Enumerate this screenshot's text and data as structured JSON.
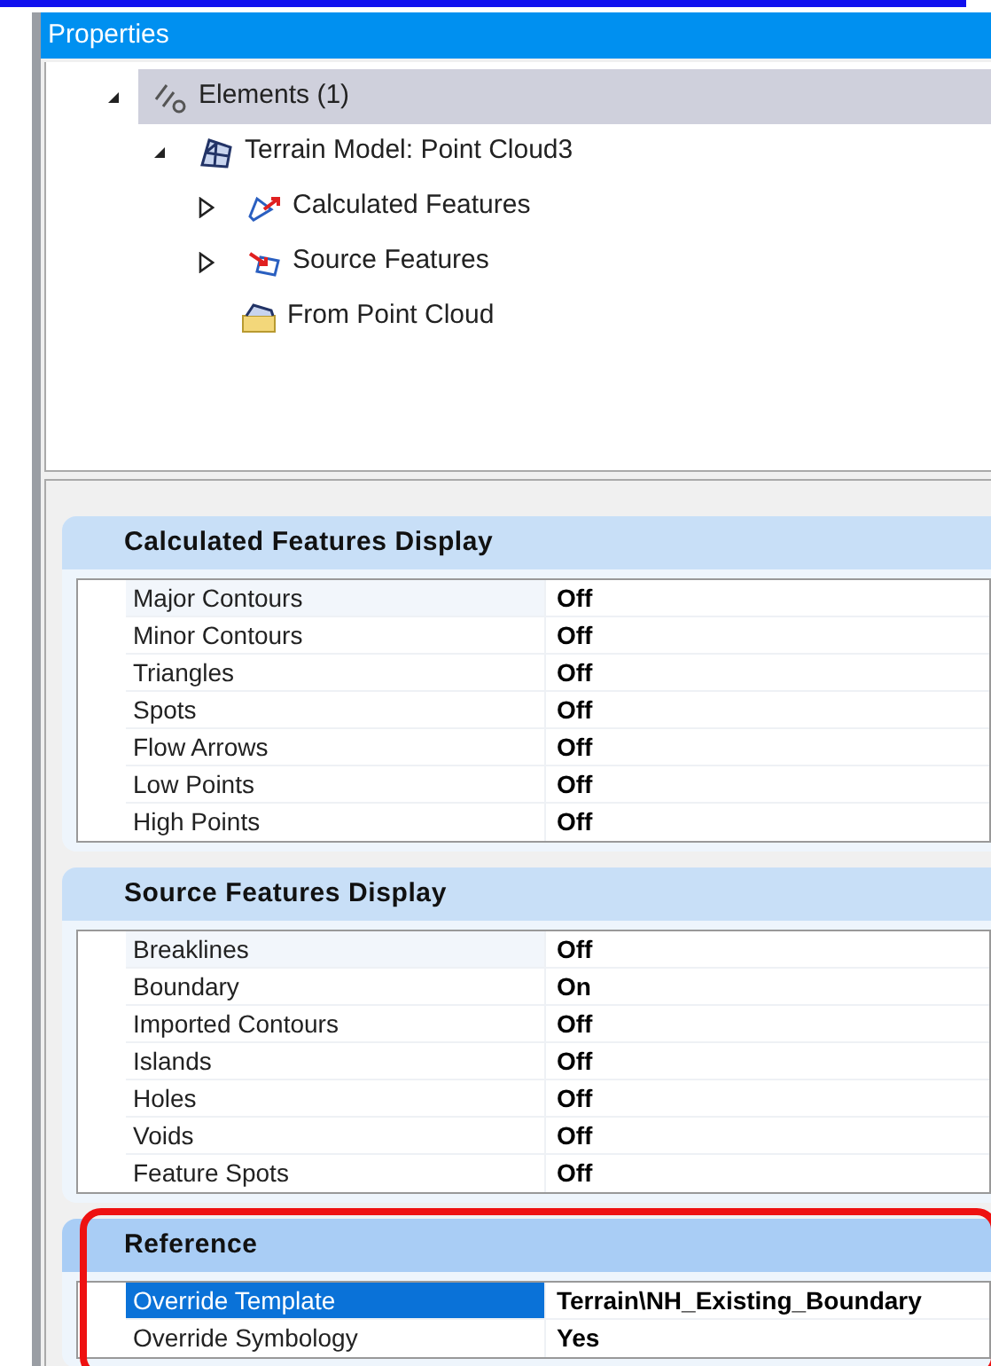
{
  "panel": {
    "title": "Properties"
  },
  "tree": [
    {
      "label": "Elements (1)",
      "kind": "elements",
      "expanded": true,
      "selected": true,
      "children": [
        {
          "label": "Terrain Model: Point Cloud3",
          "kind": "terrain",
          "expanded": true,
          "selected": false,
          "children": [
            {
              "label": "Calculated Features",
              "kind": "calculated",
              "expanded": false,
              "selected": false
            },
            {
              "label": "Source Features",
              "kind": "source",
              "expanded": false,
              "selected": false
            },
            {
              "label": "From Point Cloud",
              "kind": "cloud",
              "selected": false
            }
          ]
        }
      ]
    }
  ],
  "sections": [
    {
      "title": "Calculated Features Display",
      "highlighted": false,
      "rows": [
        {
          "name": "Major Contours",
          "value": "Off",
          "selected": false
        },
        {
          "name": "Minor Contours",
          "value": "Off",
          "selected": false
        },
        {
          "name": "Triangles",
          "value": "Off",
          "selected": false
        },
        {
          "name": "Spots",
          "value": "Off",
          "selected": false
        },
        {
          "name": "Flow Arrows",
          "value": "Off",
          "selected": false
        },
        {
          "name": "Low Points",
          "value": "Off",
          "selected": false
        },
        {
          "name": "High Points",
          "value": "Off",
          "selected": false
        }
      ]
    },
    {
      "title": "Source Features Display",
      "highlighted": false,
      "rows": [
        {
          "name": "Breaklines",
          "value": "Off",
          "selected": false
        },
        {
          "name": "Boundary",
          "value": "On",
          "selected": false
        },
        {
          "name": "Imported Contours",
          "value": "Off",
          "selected": false
        },
        {
          "name": "Islands",
          "value": "Off",
          "selected": false
        },
        {
          "name": "Holes",
          "value": "Off",
          "selected": false
        },
        {
          "name": "Voids",
          "value": "Off",
          "selected": false
        },
        {
          "name": "Feature Spots",
          "value": "Off",
          "selected": false
        }
      ]
    },
    {
      "title": "Reference",
      "highlighted": true,
      "rows": [
        {
          "name": "Override Template",
          "value": "Terrain\\NH_Existing_Boundary",
          "selected": true
        },
        {
          "name": "Override Symbology",
          "value": "Yes",
          "selected": false
        }
      ]
    }
  ]
}
